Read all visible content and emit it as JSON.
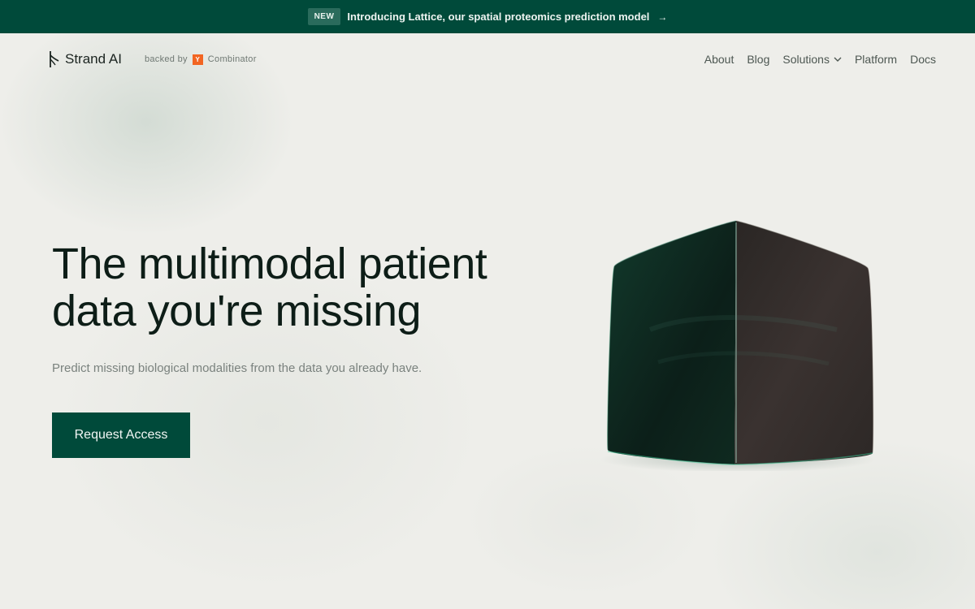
{
  "announcement": {
    "badge": "NEW",
    "message": "Introducing Lattice, our spatial proteomics prediction model",
    "arrow": "→"
  },
  "brand": {
    "name": "Strand AI",
    "backed_by": "backed by",
    "yc_letter": "Y",
    "yc_name": "Combinator"
  },
  "nav": {
    "items": [
      {
        "label": "About"
      },
      {
        "label": "Blog"
      },
      {
        "label": "Solutions"
      },
      {
        "label": "Platform"
      },
      {
        "label": "Docs"
      }
    ]
  },
  "hero": {
    "title_line1": "The multimodal patient",
    "title_line2": "data you're missing",
    "subtitle": "Predict missing biological modalities from the data you already have.",
    "cta_label": "Request Access"
  },
  "colors": {
    "brand_green": "#004a3a",
    "background": "#eeeeea",
    "yc_orange": "#f26522"
  },
  "icons": {
    "logo": "strand-mark-icon",
    "dropdown": "chevron-down-icon",
    "announcement_arrow": "arrow-right-icon",
    "hero_visual": "glass-cube"
  }
}
